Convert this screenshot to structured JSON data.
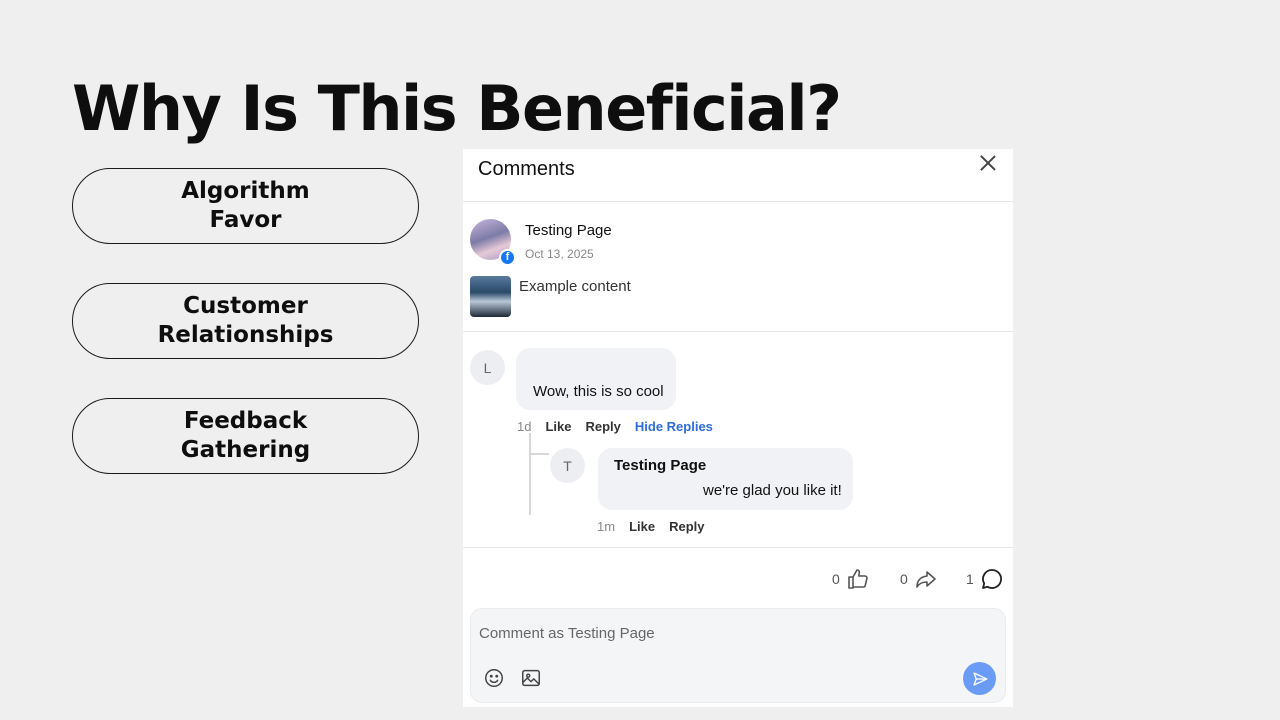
{
  "slide": {
    "title": "Why Is This Beneficial?",
    "benefits": [
      {
        "label": "Algorithm Favor"
      },
      {
        "label": "Customer Relationships"
      },
      {
        "label": "Feedback Gathering"
      }
    ]
  },
  "comments_panel": {
    "title": "Comments",
    "close_icon": "close-icon",
    "post": {
      "author": "Testing Page",
      "date": "Oct 13, 2025",
      "content": "Example content",
      "badge_icon": "facebook-badge-icon"
    },
    "comment": {
      "avatar_initial": "L",
      "text": "Wow, this is so cool",
      "age": "1d",
      "like_label": "Like",
      "reply_label": "Reply",
      "hide_replies_label": "Hide Replies"
    },
    "reply": {
      "avatar_initial": "T",
      "author": "Testing Page",
      "text": "we're glad you like it!",
      "age": "1m",
      "like_label": "Like",
      "reply_label": "Reply"
    },
    "stats": {
      "likes": "0",
      "shares": "0",
      "comments": "1"
    },
    "composer": {
      "placeholder": "Comment as Testing Page",
      "emoji_icon": "smiley-icon",
      "image_icon": "image-icon",
      "send_icon": "send-icon"
    }
  },
  "colors": {
    "background": "#efefef",
    "link_blue": "#2d6ce0",
    "send_button": "#6b9cf5",
    "facebook_blue": "#1877f2"
  }
}
